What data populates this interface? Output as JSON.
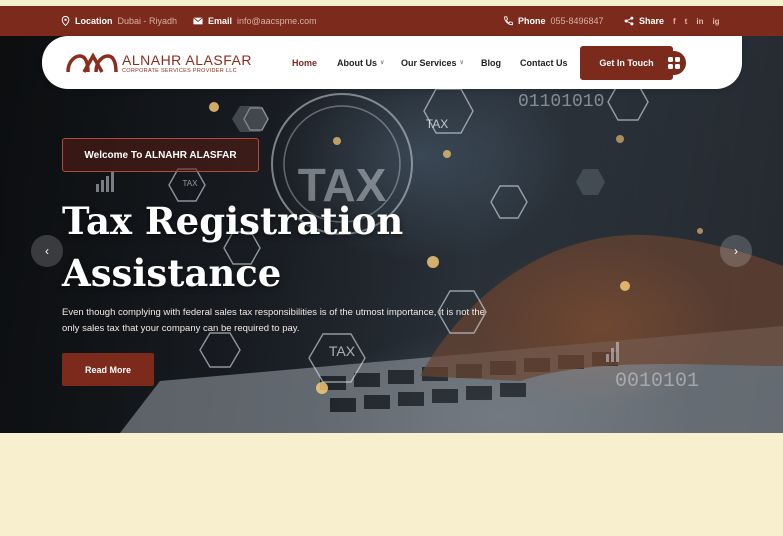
{
  "topbar": {
    "location_label": "Location",
    "location_value": "Dubai - Riyadh",
    "email_label": "Email",
    "email_value": "info@aacspme.com",
    "phone_label": "Phone",
    "phone_value": "055-8496847",
    "share_label": "Share",
    "social": [
      "f",
      "t",
      "in",
      "ig"
    ]
  },
  "logo": {
    "name": "ALNAHR ALASFAR",
    "tagline": "CORPORATE SERVICES PROVIDER LLC"
  },
  "nav": {
    "items": [
      {
        "label": "Home",
        "active": true
      },
      {
        "label": "About Us",
        "dropdown": true
      },
      {
        "label": "Our Services",
        "dropdown": true
      },
      {
        "label": "Blog"
      },
      {
        "label": "Contact Us"
      }
    ],
    "cta_label": "Get In Touch"
  },
  "hero": {
    "welcome": "Welcome To ALNAHR ALASFAR",
    "title_line1": "Tax Registration",
    "title_line2": "Assistance",
    "description": "Even though complying with federal sales tax responsibilities is of the utmost importance, it is not the only sales tax that your company can be required to pay.",
    "button_label": "Read More",
    "prev_icon": "‹",
    "next_icon": "›",
    "tax_text": "TAX"
  },
  "colors": {
    "brand": "#7b2a1c",
    "page_bg": "#f8efcf"
  }
}
